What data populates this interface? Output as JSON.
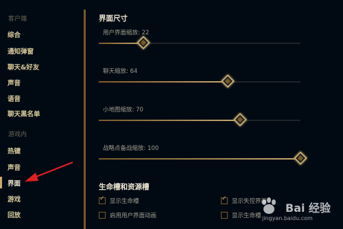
{
  "sidebar": {
    "client_header": "客户端",
    "client_items": [
      {
        "label": "综合"
      },
      {
        "label": "通知弹窗"
      },
      {
        "label": "聊天&好友"
      },
      {
        "label": "声音"
      },
      {
        "label": "语音"
      },
      {
        "label": "聊天黑名单"
      }
    ],
    "game_header": "游戏内",
    "game_items": [
      {
        "label": "热键"
      },
      {
        "label": "声音"
      },
      {
        "label": "界面",
        "active": true
      },
      {
        "label": "游戏"
      },
      {
        "label": "回放"
      }
    ]
  },
  "main": {
    "interface_size_title": "界面尺寸",
    "sliders": [
      {
        "label": "用户界面缩放: 22",
        "value": 22
      },
      {
        "label": "聊天缩放: 64",
        "value": 64
      },
      {
        "label": "小地图缩放: 70",
        "value": 70
      },
      {
        "label": "战略点备战缩放: 100",
        "value": 100
      }
    ],
    "health_bars_title": "生命槽和资源槽",
    "checkboxes": [
      {
        "label": "显示生命槽",
        "checked": true
      },
      {
        "label": "显示失控界面",
        "checked": true
      },
      {
        "label": "启用用户界面动画",
        "checked": false
      },
      {
        "label": "显示生命槽",
        "checked": false
      }
    ]
  },
  "watermark": {
    "brand": "Bai 经验",
    "url": "jingyan.baidu.com"
  },
  "colors": {
    "background": "#010a13",
    "gold": "#c8aa6e",
    "gold_dark": "#785a28",
    "arrow": "#e02020"
  }
}
